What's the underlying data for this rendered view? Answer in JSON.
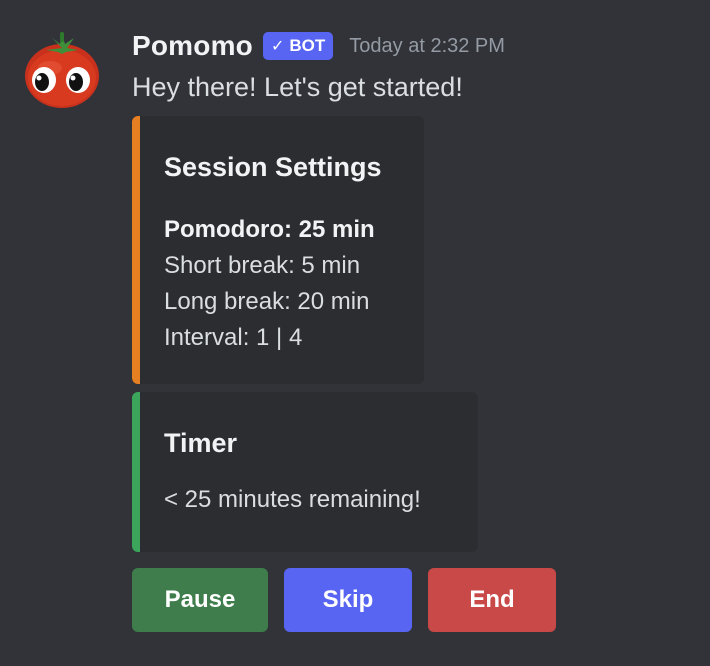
{
  "message": {
    "username": "Pomomo",
    "bot_tag": {
      "icon": "check-icon",
      "label": "BOT"
    },
    "timestamp": "Today at 2:32 PM",
    "content": "Hey there! Let's get started!"
  },
  "embeds": {
    "settings": {
      "accent_color": "#e67e22",
      "title": "Session Settings",
      "lines": [
        {
          "text": "Pomodoro: 25 min",
          "bold": true
        },
        {
          "text": "Short break: 5 min",
          "bold": false
        },
        {
          "text": "Long break: 20 min",
          "bold": false
        },
        {
          "text": "Interval: 1 | 4",
          "bold": false
        }
      ]
    },
    "timer": {
      "accent_color": "#3ba55c",
      "title": "Timer",
      "text": "< 25 minutes remaining!"
    }
  },
  "buttons": [
    {
      "label": "Pause",
      "color": "#3f7d4c"
    },
    {
      "label": "Skip",
      "color": "#5865f2"
    },
    {
      "label": "End",
      "color": "#c94848"
    }
  ],
  "avatar": {
    "icon": "tomato-avatar-icon"
  }
}
